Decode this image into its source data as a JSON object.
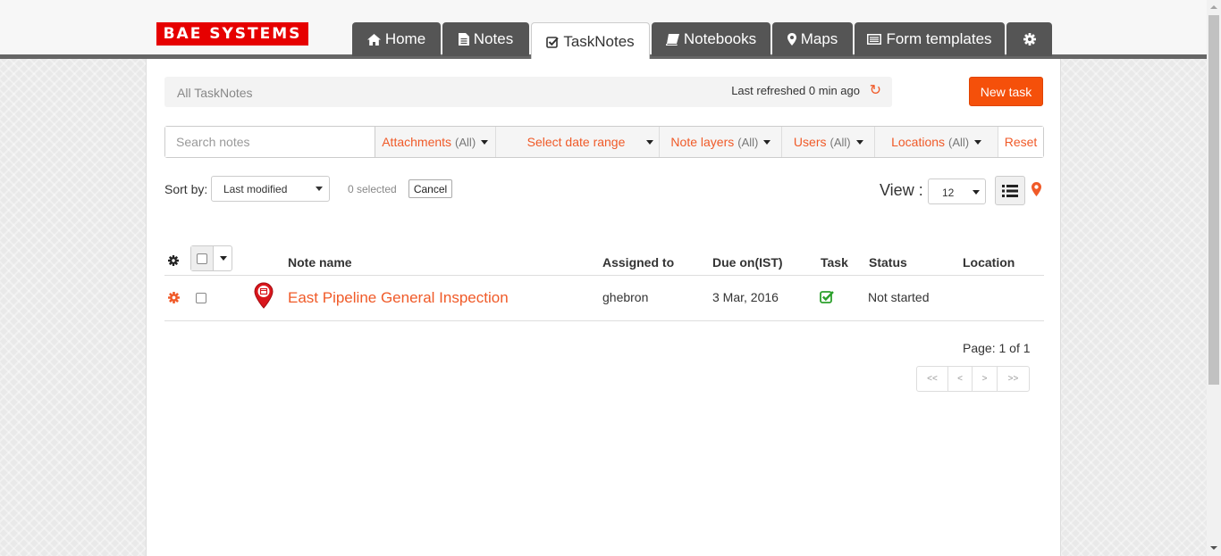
{
  "brand": {
    "logo_text": "BAE SYSTEMS",
    "logo_color": "#e60000"
  },
  "colors": {
    "accent": "#f05a28",
    "button": "#f5500a",
    "tab_bg": "#555555"
  },
  "nav": {
    "tabs": [
      {
        "label": "Home",
        "icon": "home-icon"
      },
      {
        "label": "Notes",
        "icon": "file-icon"
      },
      {
        "label": "TaskNotes",
        "icon": "check-square-icon",
        "active": true
      },
      {
        "label": "Notebooks",
        "icon": "book-icon"
      },
      {
        "label": "Maps",
        "icon": "map-marker-icon"
      },
      {
        "label": "Form templates",
        "icon": "list-alt-icon"
      },
      {
        "label": "",
        "icon": "gear-icon"
      }
    ]
  },
  "header": {
    "breadcrumb": "All TaskNotes",
    "last_refreshed": "Last refreshed 0 min ago",
    "new_task_label": "New task"
  },
  "filters": {
    "search_placeholder": "Search notes",
    "attachments": {
      "label": "Attachments",
      "value": "(All)"
    },
    "date_range": {
      "label": "Select date range"
    },
    "note_layers": {
      "label": "Note layers",
      "value": "(All)"
    },
    "users": {
      "label": "Users",
      "value": "(All)"
    },
    "locations": {
      "label": "Locations",
      "value": "(All)"
    },
    "reset_label": "Reset"
  },
  "toolbar": {
    "sort_label": "Sort by:",
    "sort_value": "Last modified",
    "selected_count": "0 selected",
    "cancel_label": "Cancel",
    "view_label": "View :",
    "view_value": "12"
  },
  "table": {
    "columns": [
      "Note name",
      "Assigned to",
      "Due on(IST)",
      "Task",
      "Status",
      "Location"
    ],
    "rows": [
      {
        "name": "East Pipeline General Inspection",
        "assigned_to": "ghebron",
        "due_on": "3 Mar, 2016",
        "task": true,
        "status": "Not started",
        "location": ""
      }
    ]
  },
  "pagination": {
    "page_info": "Page: 1 of 1",
    "first": "<<",
    "prev": "<",
    "next": ">",
    "last": ">>"
  }
}
